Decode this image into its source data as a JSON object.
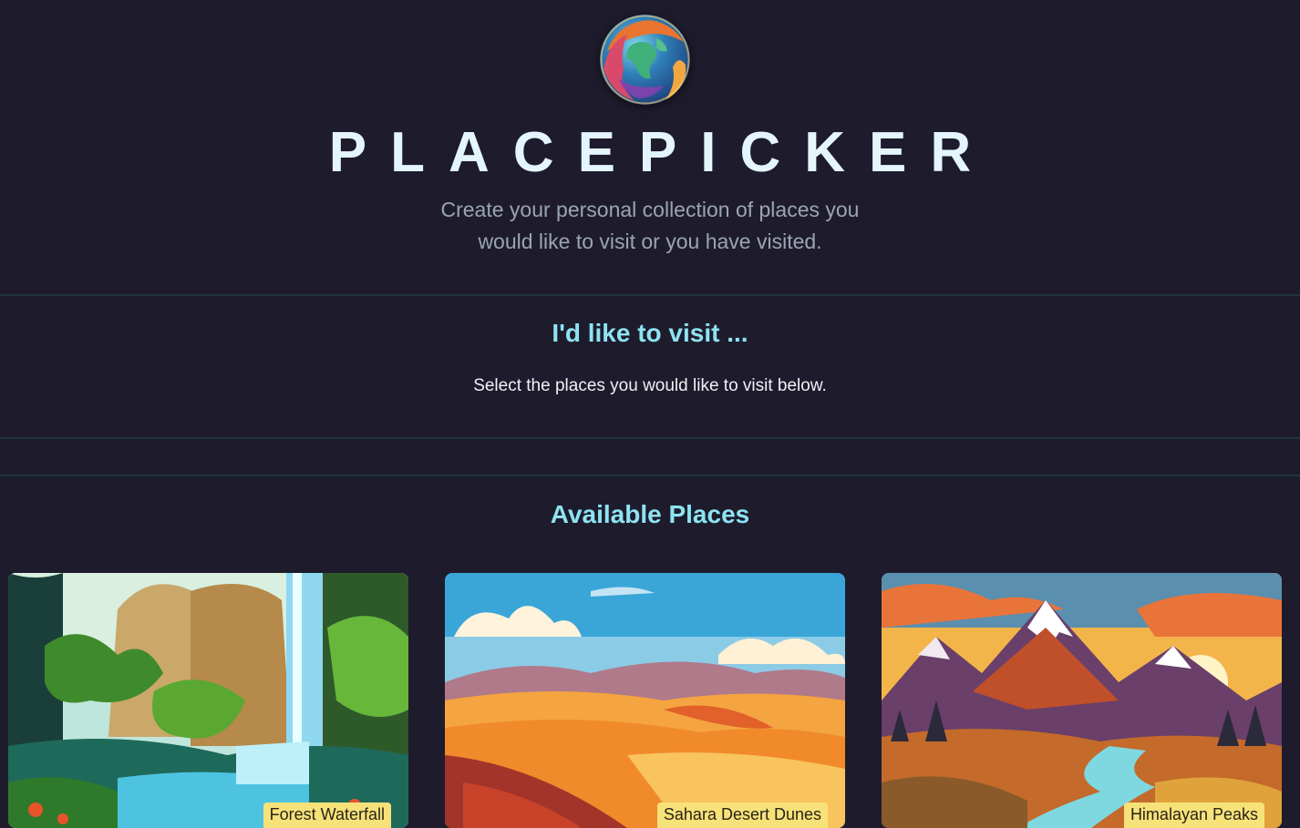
{
  "header": {
    "logo_icon": "globe-logo",
    "title": "PLACEPICKER",
    "tagline_line1": "Create your personal collection of places you",
    "tagline_line2": "would like to visit or you have visited."
  },
  "picked_section": {
    "heading": "I'd like to visit ...",
    "fallback_text": "Select the places you would like to visit below."
  },
  "available_section": {
    "heading": "Available Places",
    "places": [
      {
        "title": "Forest Waterfall",
        "image": "forest-waterfall-illustration"
      },
      {
        "title": "Sahara Desert Dunes",
        "image": "desert-dunes-illustration"
      },
      {
        "title": "Himalayan Peaks",
        "image": "mountain-peaks-illustration"
      }
    ]
  },
  "colors": {
    "background": "#1e1c2c",
    "heading_accent": "#8ee3f2",
    "label_background": "#f7e27a",
    "divider": "#1f3440"
  }
}
